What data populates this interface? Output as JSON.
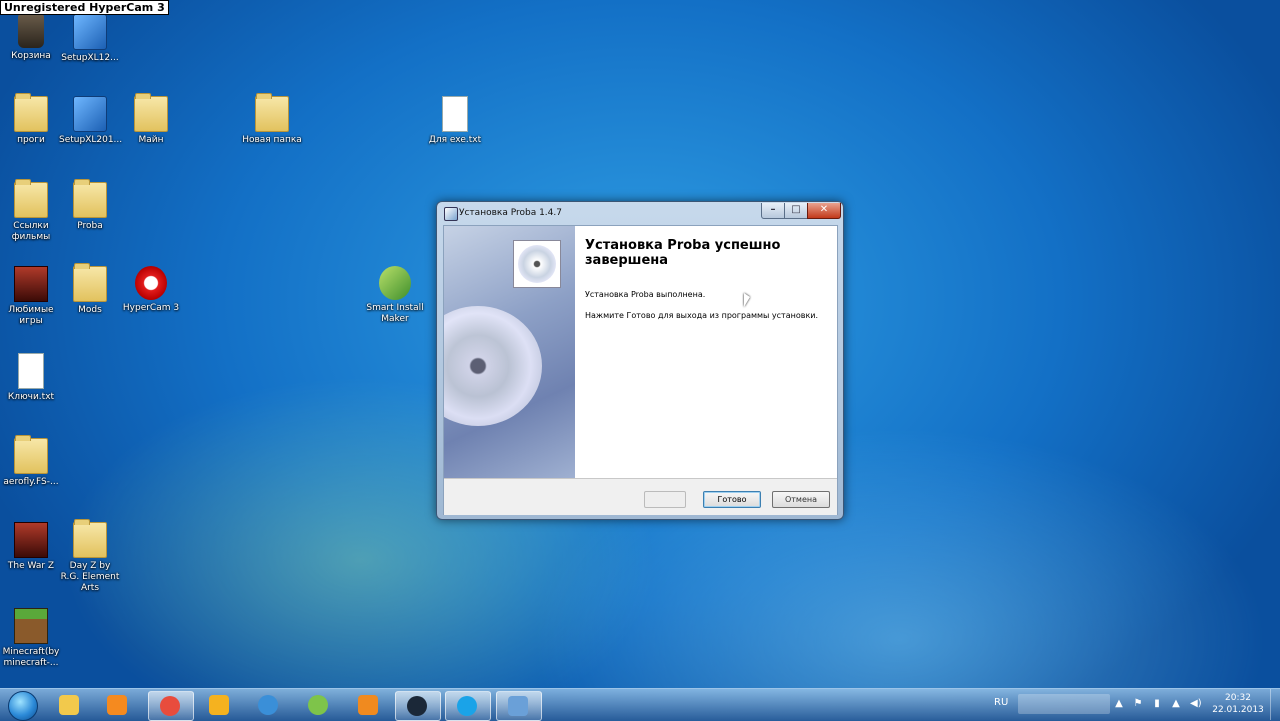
{
  "watermark": "Unregistered HyperCam 3",
  "desktop_icons": [
    {
      "label": "Корзина"
    },
    {
      "label": "SetupXL12..."
    },
    {
      "label": "проги"
    },
    {
      "label": "SetupXL201..."
    },
    {
      "label": "Майн"
    },
    {
      "label": "Новая папка"
    },
    {
      "label": "Для exe.txt"
    },
    {
      "label": "Ссылки фильмы"
    },
    {
      "label": "Proba"
    },
    {
      "label": "Любимые игры"
    },
    {
      "label": "Mods"
    },
    {
      "label": "HyperCam 3"
    },
    {
      "label": "Smart Install Maker"
    },
    {
      "label": "Ключи.txt"
    },
    {
      "label": "aerofly.FS-..."
    },
    {
      "label": "The War Z"
    },
    {
      "label": "Day Z by R.G. Element Arts"
    },
    {
      "label": "Minecraft(by minecraft-..."
    }
  ],
  "dialog": {
    "title": "Установка Proba 1.4.7",
    "minimize_glyph": "–",
    "maximize_glyph": "□",
    "close_glyph": "✕",
    "heading": "Установка Proba успешно завершена",
    "line1": "Установка Proba выполнена.",
    "line2": "Нажмите Готово для выхода из программы установки.",
    "finish_label": "Готово",
    "cancel_label": "Отмена"
  },
  "taskbar": {
    "language": "RU",
    "time": "20:32",
    "date": "22.01.2013",
    "tray_glyphs": [
      "▲",
      "⚑",
      "▮",
      "▲",
      "◀)"
    ],
    "items": [
      {
        "icon": "explorer-icon",
        "color": "#f2c94c"
      },
      {
        "icon": "media-player-icon",
        "color": "#f58a1f"
      },
      {
        "icon": "chrome-icon",
        "color": "#e84c3d"
      },
      {
        "icon": "app-icon",
        "color": "#f5b21f"
      },
      {
        "icon": "mail-icon",
        "color": "#3a8fd8"
      },
      {
        "icon": "game-icon",
        "color": "#7ec44a"
      },
      {
        "icon": "odnoklassniki-icon",
        "color": "#f08a1f"
      },
      {
        "icon": "steam-icon",
        "color": "#1b2838"
      },
      {
        "icon": "skype-icon",
        "color": "#1aa3e8"
      },
      {
        "icon": "installer-icon",
        "color": "#6aa0d8"
      }
    ]
  },
  "colors": {
    "desktop": "#1370c6",
    "dialog_frame": "#9fb8d3",
    "close_button": "#c2391b"
  }
}
